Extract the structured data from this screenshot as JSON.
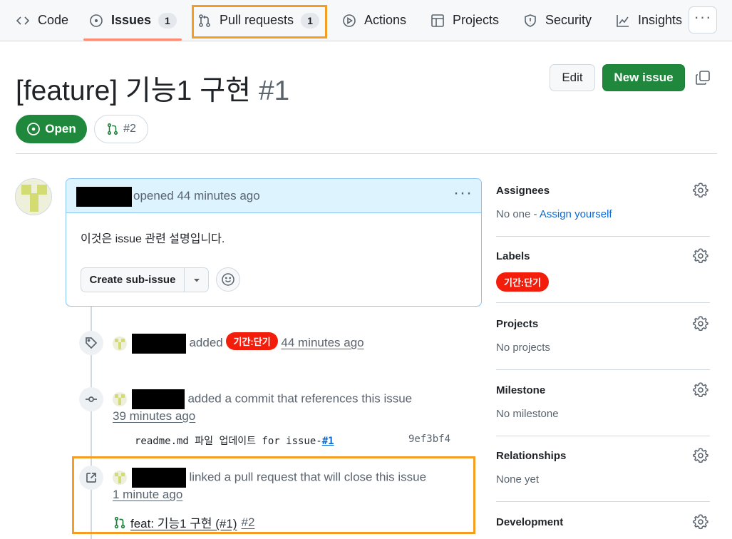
{
  "nav": {
    "code": "Code",
    "issues": "Issues",
    "issues_count": "1",
    "pull_requests": "Pull requests",
    "pull_requests_count": "1",
    "actions": "Actions",
    "projects": "Projects",
    "security": "Security",
    "insights": "Insights",
    "more": "···"
  },
  "header": {
    "title": "[feature] 기능1 구현",
    "number": "#1",
    "edit": "Edit",
    "new_issue": "New issue",
    "state": "Open",
    "linked_pr": "#2"
  },
  "comment": {
    "meta": "opened 44 minutes ago",
    "body": "이것은 issue 관련 설명입니다.",
    "sub_issue": "Create sub-issue",
    "dots": "···"
  },
  "timeline": {
    "label_event": {
      "action": "added",
      "label": "기간:단기",
      "time": "44 minutes ago"
    },
    "commit_event": {
      "action": "added a commit that references this issue",
      "time": "39 minutes ago",
      "commit_message": "readme.md 파일 업데이트 for issue-",
      "commit_ref": "#1",
      "sha": "9ef3bf4"
    },
    "pr_event": {
      "action": "linked a pull request that will close this issue",
      "time": "1 minute ago",
      "pr_title": "feat: 기능1 구현 (#1)",
      "pr_number": "#2"
    }
  },
  "sidebar": {
    "assignees": {
      "title": "Assignees",
      "value": "No one - ",
      "assign": "Assign yourself"
    },
    "labels": {
      "title": "Labels",
      "label": "기간:단기"
    },
    "projects": {
      "title": "Projects",
      "value": "No projects"
    },
    "milestone": {
      "title": "Milestone",
      "value": "No milestone"
    },
    "relationships": {
      "title": "Relationships",
      "value": "None yet"
    },
    "development": {
      "title": "Development"
    }
  },
  "colors": {
    "open_green": "#1f883d",
    "label_red": "#f31d0b",
    "highlight_orange": "#f59d22",
    "link_blue": "#0969da"
  },
  "icons": [
    "code-icon",
    "issue-opened-icon",
    "git-pull-request-icon",
    "play-icon",
    "table-icon",
    "shield-icon",
    "graph-icon",
    "kebab-horizontal-icon",
    "copy-icon",
    "tag-icon",
    "git-commit-icon",
    "link-external-icon",
    "gear-icon",
    "smiley-icon",
    "triangle-down-icon"
  ]
}
